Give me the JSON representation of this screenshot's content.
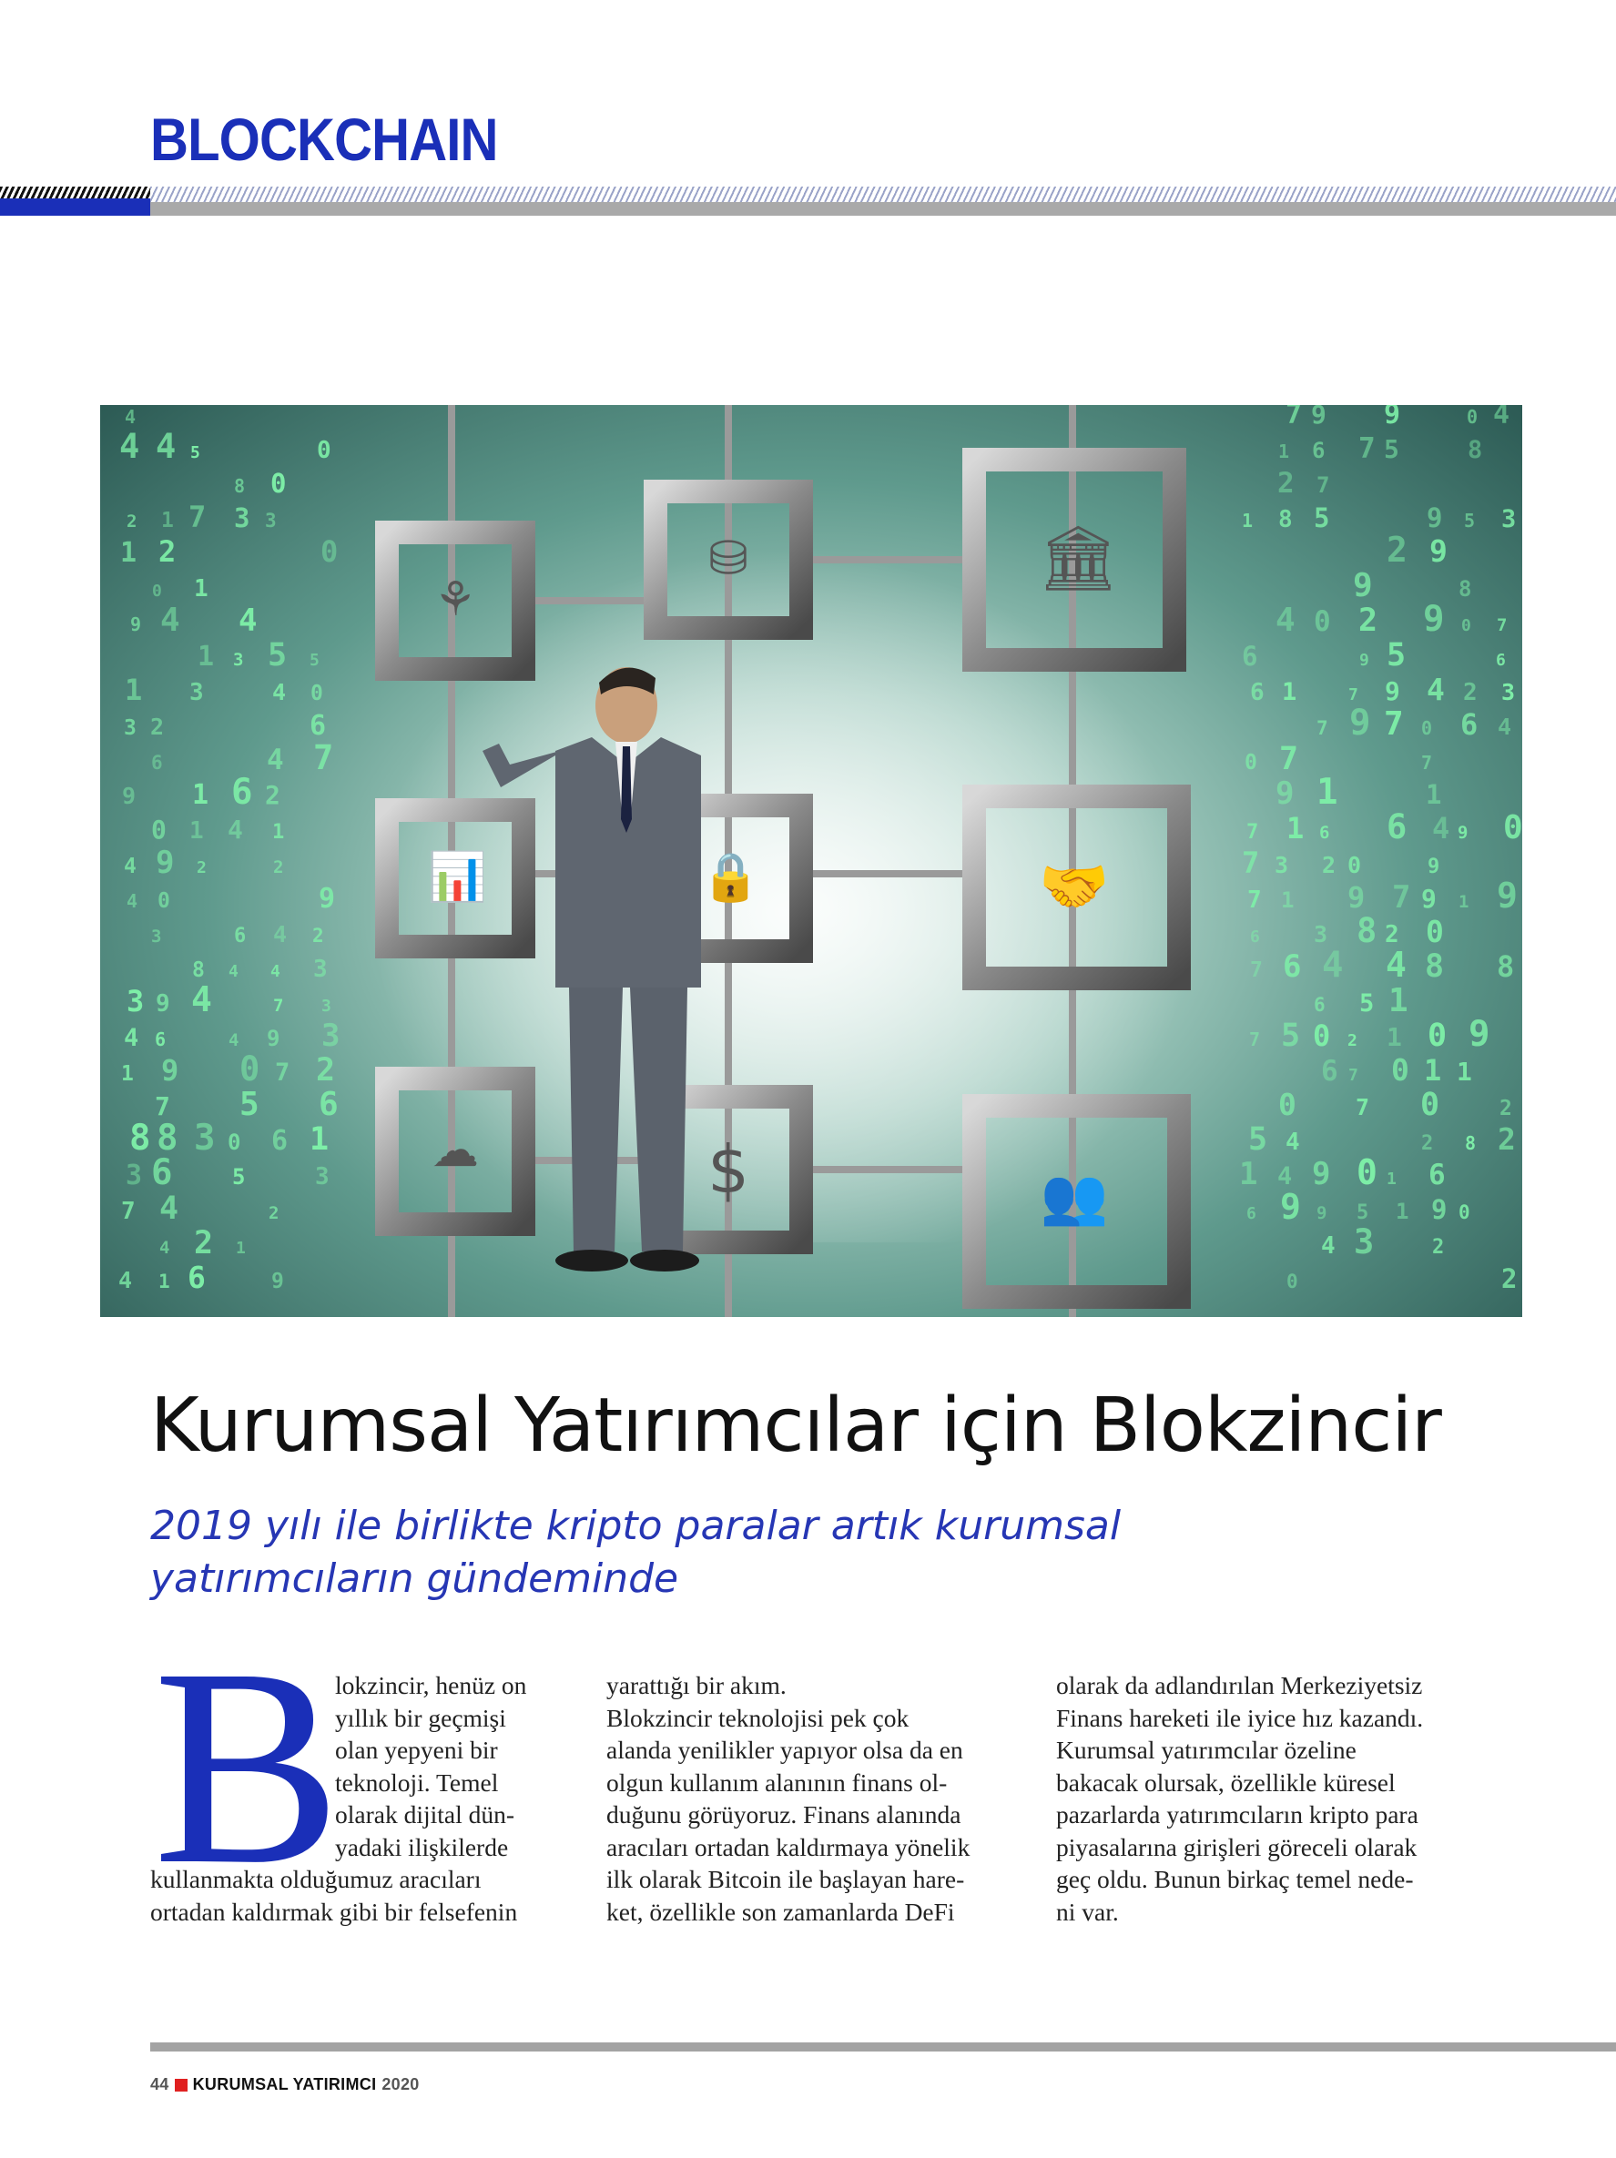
{
  "header": {
    "section": "BLOCKCHAIN"
  },
  "photo": {
    "icons": [
      "brain-icon",
      "coins-icon",
      "bank-icon",
      "growth-chart-icon",
      "padlock-icon",
      "handshake-icon",
      "cloud-icon",
      "dollar-icon",
      "people-icon"
    ]
  },
  "article": {
    "title": "Kurumsal Yatırımcılar için Blokzincir",
    "subtitle_lines": [
      "2019 yılı ile birlikte kripto paralar artık kurumsal",
      "yatırımcıların gündeminde"
    ],
    "dropcap": "B",
    "col1a": [
      "lokzincir, henüz on",
      "yıllık bir geçmişi",
      "olan yepyeni bir",
      "teknoloji. Temel",
      "olarak dijital dün-",
      "yadaki ilişkilerde"
    ],
    "col1b": [
      "kullanmakta olduğumuz aracıları",
      "ortadan kaldırmak gibi bir felsefenin"
    ],
    "col2": [
      "yarattığı bir akım.",
      "Blokzincir teknolojisi pek çok",
      "alanda yenilikler yapıyor olsa da en",
      "olgun kullanım alanının finans ol-",
      "duğunu görüyoruz. Finans alanında",
      "aracıları ortadan kaldırmaya yönelik",
      "ilk olarak Bitcoin ile başlayan hare-",
      "ket, özellikle son zamanlarda DeFi"
    ],
    "col3": [
      "olarak da adlandırılan Merkeziyetsiz",
      "Finans hareketi ile iyice hız kazandı.",
      "Kurumsal yatırımcılar özeline",
      "bakacak olursak, özellikle küresel",
      "pazarlarda yatırımcıların kripto para",
      "piyasalarına girişleri göreceli olarak",
      "geç oldu. Bunun birkaç temel nede-",
      "ni var."
    ]
  },
  "footer": {
    "page_number": "44",
    "magazine": "KURUMSAL YATIRIMCI",
    "year": "2020"
  },
  "colors": {
    "accent_blue": "#1a2fb8",
    "subtitle_blue": "#2636b4",
    "footer_square": "#e02020"
  }
}
